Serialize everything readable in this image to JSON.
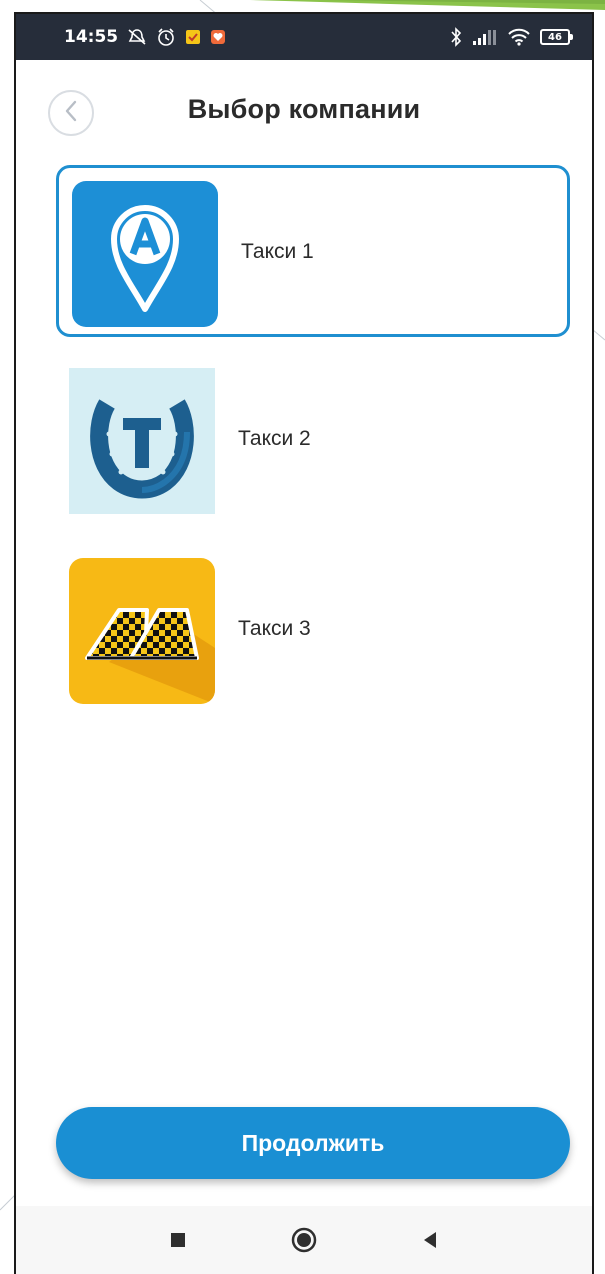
{
  "status_bar": {
    "time": "14:55",
    "battery": "46",
    "left_icons": [
      "mute-icon",
      "alarm-icon",
      "notification-icon",
      "app-notification-icon"
    ],
    "right_icons": [
      "bluetooth-icon",
      "signal-icon",
      "wifi-icon",
      "battery-icon"
    ]
  },
  "header": {
    "title": "Выбор компании",
    "back_icon": "chevron-left-icon"
  },
  "companies": [
    {
      "name": "Такси 1",
      "logo": "taxi-pin-a-logo",
      "selected": true
    },
    {
      "name": "Такси 2",
      "logo": "taxi-horseshoe-t-logo",
      "selected": false
    },
    {
      "name": "Такси 3",
      "logo": "taxi-checker-logo",
      "selected": false
    }
  ],
  "continue_button": {
    "label": "Продолжить"
  },
  "nav_bar": {
    "icons": [
      "recents-icon",
      "home-icon",
      "back-icon"
    ]
  },
  "colors": {
    "accent": "#1a8fd3",
    "status_bar": "#262d3a",
    "selected_border": "#1f8fd0",
    "slide_decoration": "#8bc34a"
  }
}
